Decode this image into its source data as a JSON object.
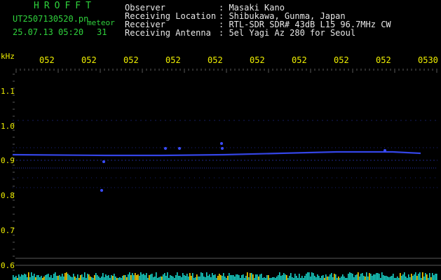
{
  "app": {
    "logo_text": "HROFFT"
  },
  "file": {
    "name": "UT2507130520.pn",
    "type_label": "meteor"
  },
  "timestamp": {
    "datetime": "25.07.13 05:20",
    "count": "31"
  },
  "info": {
    "rows": [
      {
        "label": "Observer",
        "value": ": Masaki Kano"
      },
      {
        "label": "Receiving Location",
        "value": ": Shibukawa, Gunma, Japan"
      },
      {
        "label": "Receiver",
        "value": ": RTL-SDR SDR# 43dB L15 96.7MHz CW"
      },
      {
        "label": "Receiving Antenna",
        "value": ": 5el Yagi Az 280 for Seoul"
      }
    ]
  },
  "axis": {
    "y_unit": "kHz",
    "y_ticks": [
      "1.1",
      "1.0",
      "0.9",
      "0.8",
      "0.7",
      "0.6"
    ],
    "x_ticks": [
      "052",
      "052",
      "052",
      "052",
      "052",
      "052",
      "052",
      "052",
      "052",
      "0530"
    ]
  },
  "colors": {
    "background": "#000000",
    "text": "#2fd23c",
    "header": "#e8e8e8",
    "time_ticks": "#f0f000",
    "signal": "#3a4cff",
    "grid": "#5a5a5a"
  }
}
